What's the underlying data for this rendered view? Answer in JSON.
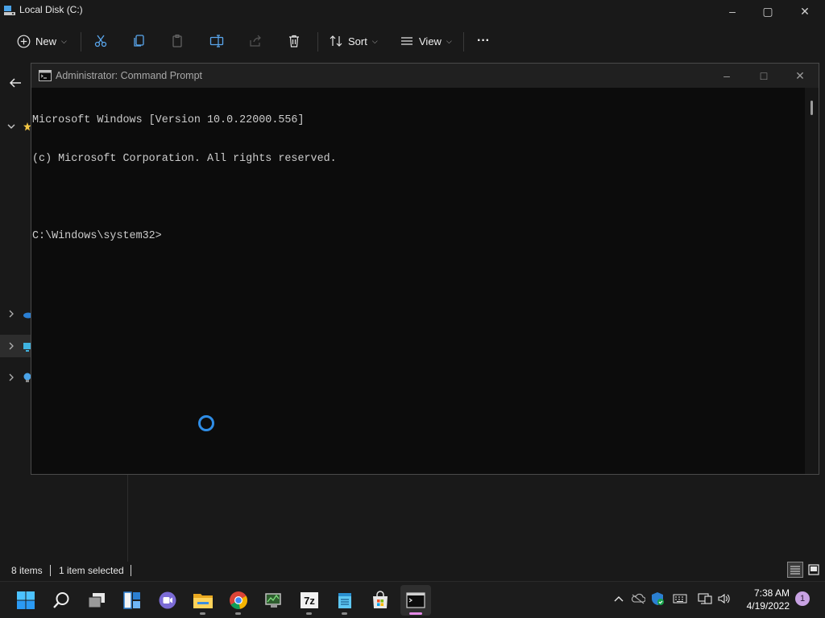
{
  "explorer": {
    "title": "Local Disk (C:)",
    "caption": {
      "minimize": "–",
      "maximize": "▢",
      "close": "✕"
    },
    "toolbar": {
      "new_label": "New",
      "sort_label": "Sort",
      "view_label": "View",
      "more_label": "···"
    },
    "status": {
      "items_count": "8 items",
      "selection": "1 item selected"
    }
  },
  "cmd": {
    "title": "Administrator: Command Prompt",
    "caption": {
      "minimize": "–",
      "maximize": "□",
      "close": "✕"
    },
    "lines": [
      "Microsoft Windows [Version 10.0.22000.556]",
      "(c) Microsoft Corporation. All rights reserved.",
      "",
      "C:\\Windows\\system32>"
    ]
  },
  "taskbar": {
    "apps": [
      {
        "name": "start",
        "icon": "windows-logo-icon"
      },
      {
        "name": "search",
        "icon": "search-icon"
      },
      {
        "name": "task-view",
        "icon": "task-view-icon"
      },
      {
        "name": "widgets",
        "icon": "widgets-icon"
      },
      {
        "name": "chat",
        "icon": "teams-chat-icon"
      },
      {
        "name": "file-explorer",
        "icon": "folder-icon"
      },
      {
        "name": "chrome",
        "icon": "chrome-icon"
      },
      {
        "name": "app-green",
        "icon": "monitor-app-icon"
      },
      {
        "name": "7zip",
        "icon": "7zip-icon",
        "label": "7z"
      },
      {
        "name": "notepad",
        "icon": "notepad-icon"
      },
      {
        "name": "store",
        "icon": "store-icon"
      },
      {
        "name": "command-prompt",
        "icon": "terminal-icon"
      }
    ],
    "clock": {
      "time": "7:38 AM",
      "date": "4/19/2022"
    },
    "notifications": "1",
    "colors": {
      "accent": "#2f8de6",
      "active_indicator": "#e48ae6"
    }
  }
}
